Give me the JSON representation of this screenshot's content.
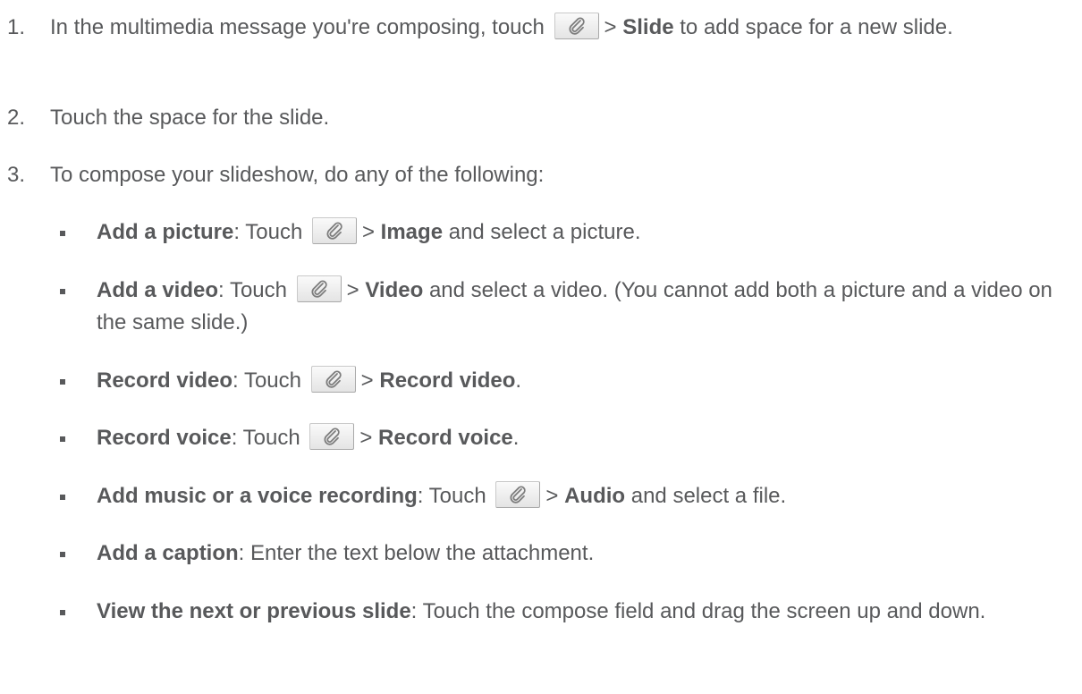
{
  "steps": [
    {
      "num": "1.",
      "pre": "In the multimedia message you're composing, touch",
      "gt": ">",
      "bold": "Slide",
      "post": "to add space for a new slide."
    },
    {
      "num": "2.",
      "text": "Touch the space for the slide."
    },
    {
      "num": "3.",
      "text": "To compose your slideshow, do any of the following:"
    }
  ],
  "bullets": [
    {
      "bold": "Add a picture",
      "colon": ":",
      "pre": "Touch",
      "gt": ">",
      "target": "Image",
      "post": "and select a picture."
    },
    {
      "bold": "Add a video",
      "colon": ":",
      "pre": "Touch",
      "gt": ">",
      "target": "Video",
      "post": "and select a video. (You cannot add both a picture and a video on the same slide.)"
    },
    {
      "bold": "Record video",
      "colon": ":",
      "pre": "Touch",
      "gt": ">",
      "target": "Record video",
      "post": "."
    },
    {
      "bold": "Record voice",
      "colon": ":",
      "pre": "Touch",
      "gt": ">",
      "target": "Record voice",
      "post": "."
    },
    {
      "bold": "Add music or a voice recording",
      "colon": ":",
      "pre": "Touch",
      "gt": ">",
      "target": "Audio",
      "post": "and select a file."
    },
    {
      "bold": "Add a caption",
      "colon": ":",
      "text": "Enter the text below the attachment."
    },
    {
      "bold": "View the next or previous slide",
      "colon": ":",
      "text": "Touch the compose field and drag the screen up and down."
    }
  ],
  "icons": {
    "attach": "paperclip-icon"
  },
  "colors": {
    "text": "#58595b",
    "icon_border": "#c9c9c9"
  }
}
